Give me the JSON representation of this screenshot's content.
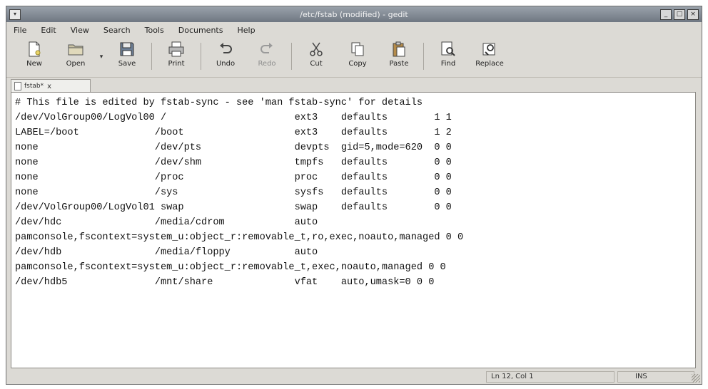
{
  "window": {
    "title": "/etc/fstab (modified) - gedit",
    "controls": [
      "minimize-icon",
      "maximize-icon",
      "close-icon"
    ]
  },
  "menu": [
    "File",
    "Edit",
    "View",
    "Search",
    "Tools",
    "Documents",
    "Help"
  ],
  "toolbar": {
    "new": "New",
    "open": "Open",
    "save": "Save",
    "print": "Print",
    "undo": "Undo",
    "redo": "Redo",
    "cut": "Cut",
    "copy": "Copy",
    "paste": "Paste",
    "find": "Find",
    "replace": "Replace"
  },
  "tab": {
    "label": "fstab*",
    "close": "x"
  },
  "editor": {
    "lines": [
      "# This file is edited by fstab-sync - see 'man fstab-sync' for details",
      "/dev/VolGroup00/LogVol00 /                      ext3    defaults        1 1",
      "LABEL=/boot             /boot                   ext3    defaults        1 2",
      "none                    /dev/pts                devpts  gid=5,mode=620  0 0",
      "none                    /dev/shm                tmpfs   defaults        0 0",
      "none                    /proc                   proc    defaults        0 0",
      "none                    /sys                    sysfs   defaults        0 0",
      "/dev/VolGroup00/LogVol01 swap                   swap    defaults        0 0",
      "/dev/hdc                /media/cdrom            auto",
      "pamconsole,fscontext=system_u:object_r:removable_t,ro,exec,noauto,managed 0 0",
      "/dev/hdb                /media/floppy           auto",
      "pamconsole,fscontext=system_u:object_r:removable_t,exec,noauto,managed 0 0",
      "/dev/hdb5               /mnt/share              vfat    auto,umask=0 0 0"
    ]
  },
  "status": {
    "position": "Ln 12, Col 1",
    "mode": "INS"
  }
}
